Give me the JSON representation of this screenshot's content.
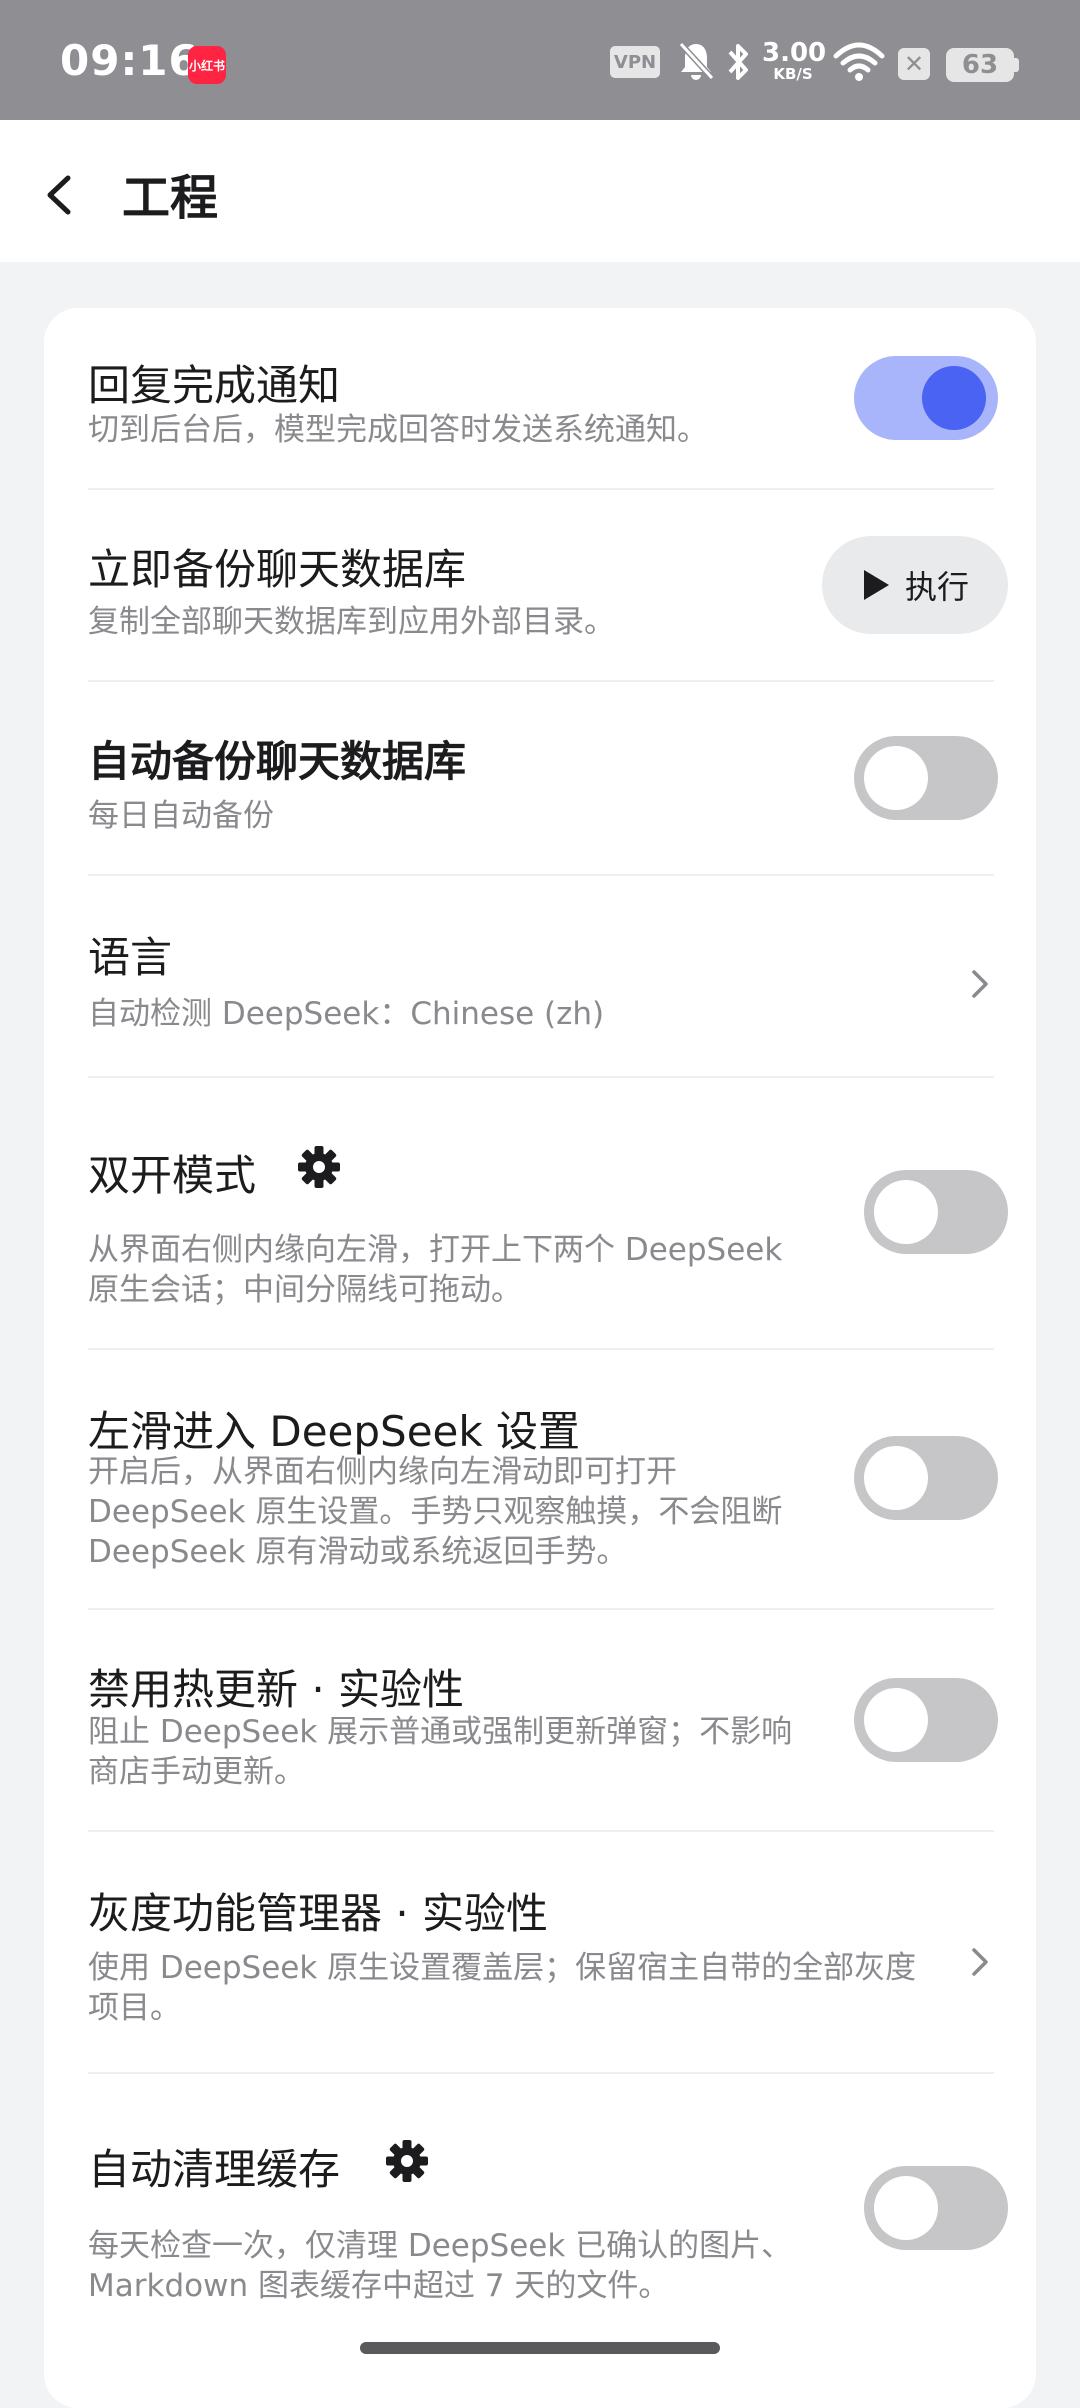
{
  "status_bar": {
    "time": "09:16",
    "app_badge": "小红书",
    "vpn": "VPN",
    "speed_value": "3.00",
    "speed_unit": "KB/S",
    "battery": "63",
    "icons": [
      "silent-bell-icon",
      "bluetooth-icon",
      "wifi-icon",
      "close-box-icon",
      "battery-icon"
    ]
  },
  "header": {
    "title": "工程"
  },
  "settings": [
    {
      "title": "回复完成通知",
      "desc": "切到后台后，模型完成回答时发送系统通知。",
      "control": "toggle",
      "on": true
    },
    {
      "title": "立即备份聊天数据库",
      "desc": "复制全部聊天数据库到应用外部目录。",
      "control": "button",
      "button_label": "执行"
    },
    {
      "title": "自动备份聊天数据库",
      "desc": "每日自动备份",
      "control": "toggle",
      "on": false
    },
    {
      "title": "语言",
      "desc": "自动检测 DeepSeek：Chinese (zh)",
      "control": "chevron"
    },
    {
      "title": "双开模式",
      "desc_lines": [
        "从界面右侧内缘向左滑，打开上下两个 DeepSeek",
        "原生会话；中间分隔线可拖动。"
      ],
      "control": "toggle",
      "on": false,
      "gear": true
    },
    {
      "title": "左滑进入 DeepSeek 设置",
      "desc_lines": [
        "开启后，从界面右侧内缘向左滑动即可打开",
        "DeepSeek 原生设置。手势只观察触摸，不会阻断",
        "DeepSeek 原有滑动或系统返回手势。"
      ],
      "control": "toggle",
      "on": false
    },
    {
      "title": "禁用热更新 · 实验性",
      "desc_lines": [
        "阻止 DeepSeek 展示普通或强制更新弹窗；不影响",
        "商店手动更新。"
      ],
      "control": "toggle",
      "on": false
    },
    {
      "title": "灰度功能管理器 · 实验性",
      "desc_lines": [
        "使用 DeepSeek 原生设置覆盖层；保留宿主自带的全部灰度",
        "项目。"
      ],
      "control": "chevron"
    },
    {
      "title": "自动清理缓存",
      "desc_lines": [
        "每天检查一次，仅清理 DeepSeek 已确认的图片、",
        "Markdown 图表缓存中超过 7 天的文件。"
      ],
      "control": "toggle",
      "on": false,
      "gear": true
    }
  ],
  "colors": {
    "accent": "#4a63f2",
    "accent_track": "#a9b5fb",
    "toggle_off": "#c6c6c8"
  }
}
